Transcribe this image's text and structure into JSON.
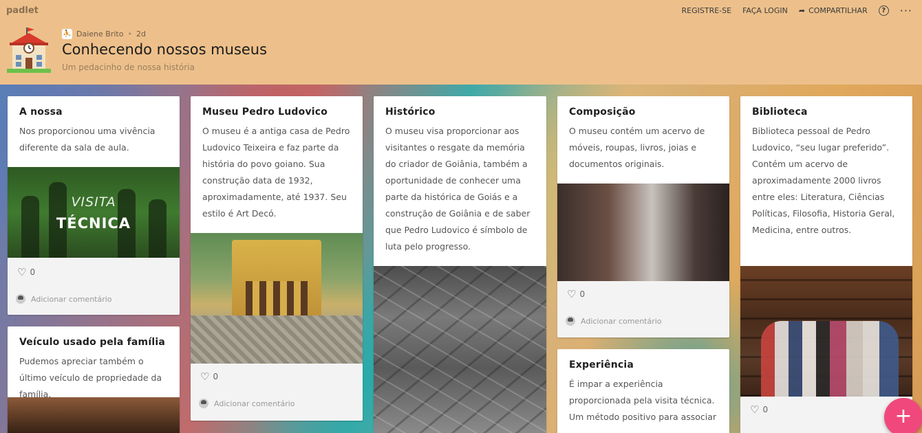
{
  "app": {
    "logo": "padlet"
  },
  "topnav": {
    "register": "REGISTRE-SE",
    "login": "FAÇA LOGIN",
    "share": "COMPARTILHAR",
    "help": "?",
    "more": "···"
  },
  "board": {
    "author": "Daiene Brito",
    "time": "2d",
    "title": "Conhecendo nossos museus",
    "subtitle": "Um pedacinho de nossa história"
  },
  "posts": [
    {
      "title": "A nossa",
      "body": "Nos proporcionou uma vivência diferente da sala de aula.",
      "image_text": [
        "VISITA",
        "TÉCNICA"
      ],
      "likes": "0",
      "comment_placeholder": "Adicionar comentário"
    },
    {
      "title": "Museu Pedro Ludovico",
      "body": "O museu é a antiga casa de Pedro Ludovico Teixeira e faz parte da história do povo goiano. Sua construção data de 1932, aproximadamente, até 1937. Seu estilo é Art Decó.",
      "likes": "0",
      "comment_placeholder": "Adicionar comentário"
    },
    {
      "title": "Histórico",
      "body": "O museu visa proporcionar aos visitantes o resgate da memória do criador de Goiânia, também a oportunidade de conhecer uma parte da histórica de Goiás e a construção de Goiânia e de saber que Pedro Ludovico é símbolo de luta pelo progresso."
    },
    {
      "title": "Composição",
      "body": "O museu contém um acervo de móveis, roupas, livros, joias e documentos originais.",
      "likes": "0",
      "comment_placeholder": "Adicionar comentário"
    },
    {
      "title": "Biblioteca",
      "body": "Biblioteca pessoal de Pedro Ludovico, “seu lugar preferido”. Contém um acervo de aproximadamente 2000 livros entre eles: Literatura, Ciências Políticas, Filosofia, Historia Geral, Medicina, entre outros.",
      "likes": "0"
    },
    {
      "title": "Veículo usado pela família",
      "body": "Pudemos apreciar também o último veículo de propriedade da família."
    },
    {
      "title": "Experiência",
      "body": "É impar a experiência proporcionada pela visita técnica. Um método positivo para associar"
    }
  ],
  "fab": {
    "label": "+"
  },
  "colors": {
    "header": "#edc08b",
    "fab": "#f0487d"
  }
}
